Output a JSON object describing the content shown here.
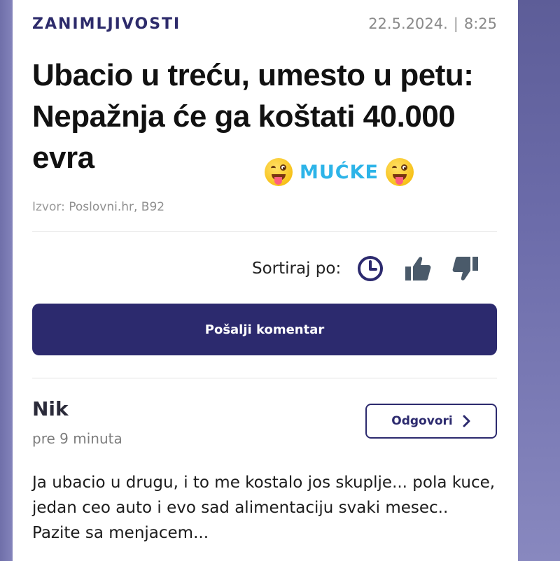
{
  "article": {
    "category": "ZANIMLJIVOSTI",
    "date": "22.5.2024.",
    "separator": "|",
    "time": "8:25",
    "headline": "Ubacio u treću, umesto u petu: Nepažnja će ga koštati 40.000 evra",
    "sticker_text": "MUĆKE",
    "source_label": "Izvor:",
    "source_value": "Poslovni.hr, B92"
  },
  "sorting": {
    "label": "Sortiraj po:",
    "options": [
      "clock-icon",
      "thumbs-up-icon",
      "thumbs-down-icon"
    ]
  },
  "send_button": {
    "label": "Pošalji komentar"
  },
  "comment": {
    "author": "Nik",
    "time": "pre 9 minuta",
    "reply_label": "Odgovori",
    "text": "Ja ubacio u drugu, i to me kostalo jos skuplje... pola kuce, jedan ceo auto i evo sad alimentaciju svaki mesec.. Pazite sa menjacem..."
  },
  "colors": {
    "brand": "#2c2a6e",
    "sticker": "#2db4e8",
    "sort_icons": "#2c2a6e",
    "thumb_icons": "#4a5a6a"
  }
}
